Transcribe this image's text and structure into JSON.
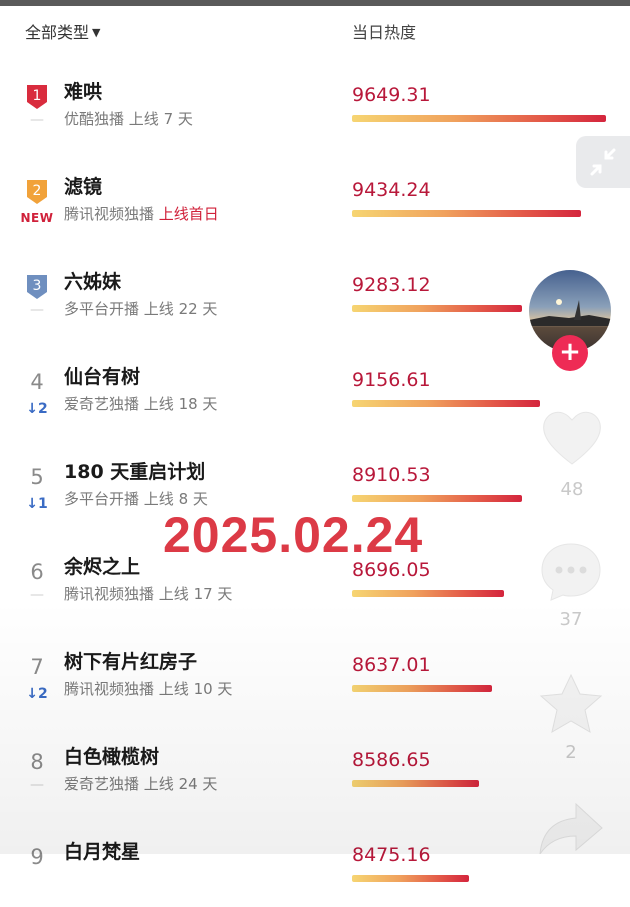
{
  "header": {
    "filter_label": "全部类型",
    "column_label": "当日热度"
  },
  "rows": [
    {
      "rank": "1",
      "title": "难哄",
      "platform": "优酷独播",
      "online": "上线 7 天",
      "online_highlight": false,
      "change_type": "dash",
      "change": "—",
      "score": "9649.31",
      "score_value": 9649.31,
      "badge_color": "#d92c3e"
    },
    {
      "rank": "2",
      "title": "滤镜",
      "platform": "腾讯视频独播",
      "online": "上线首日",
      "online_highlight": true,
      "change_type": "new",
      "change": "NEW",
      "score": "9434.24",
      "score_value": 9434.24,
      "badge_color": "#f1a23a"
    },
    {
      "rank": "3",
      "title": "六姊妹",
      "platform": "多平台开播",
      "online": "上线 22 天",
      "online_highlight": false,
      "change_type": "dash",
      "change": "—",
      "score": "9283.12",
      "score_value": 9283.12,
      "badge_color": "#6f8fbf"
    },
    {
      "rank": "4",
      "title": "仙台有树",
      "platform": "爱奇艺独播",
      "online": "上线 18 天",
      "online_highlight": false,
      "change_type": "down",
      "change": "↓2",
      "score": "9156.61",
      "score_value": 9156.61
    },
    {
      "rank": "5",
      "title": "180 天重启计划",
      "platform": "多平台开播",
      "online": "上线 8 天",
      "online_highlight": false,
      "change_type": "down",
      "change": "↓1",
      "score": "8910.53",
      "score_value": 8910.53
    },
    {
      "rank": "6",
      "title": "余烬之上",
      "platform": "腾讯视频独播",
      "online": "上线 17 天",
      "online_highlight": false,
      "change_type": "dash",
      "change": "—",
      "score": "8696.05",
      "score_value": 8696.05
    },
    {
      "rank": "7",
      "title": "树下有片红房子",
      "platform": "腾讯视频独播",
      "online": "上线 10 天",
      "online_highlight": false,
      "change_type": "down",
      "change": "↓2",
      "score": "8637.01",
      "score_value": 8637.01
    },
    {
      "rank": "8",
      "title": "白色橄榄树",
      "platform": "爱奇艺独播",
      "online": "上线 24 天",
      "online_highlight": false,
      "change_type": "dash",
      "change": "—",
      "score": "8586.65",
      "score_value": 8586.65
    },
    {
      "rank": "9",
      "title": "白月梵星",
      "platform": "",
      "online": "",
      "online_highlight": false,
      "change_type": "dash",
      "change": "",
      "score": "8475.16",
      "score_value": 8475.16
    }
  ],
  "bar_fill": [
    1.0,
    0.9,
    0.67,
    0.74,
    0.67,
    0.6,
    0.55,
    0.5,
    0.46
  ],
  "watermark": "2025.02.24",
  "side": {
    "likes": "48",
    "comments": "37",
    "favorites": "2"
  },
  "colors": {
    "accent_red": "#d0213a",
    "score_red": "#b8183a",
    "down_blue": "#3a6bc4",
    "follow_pink": "#ee2b55"
  }
}
